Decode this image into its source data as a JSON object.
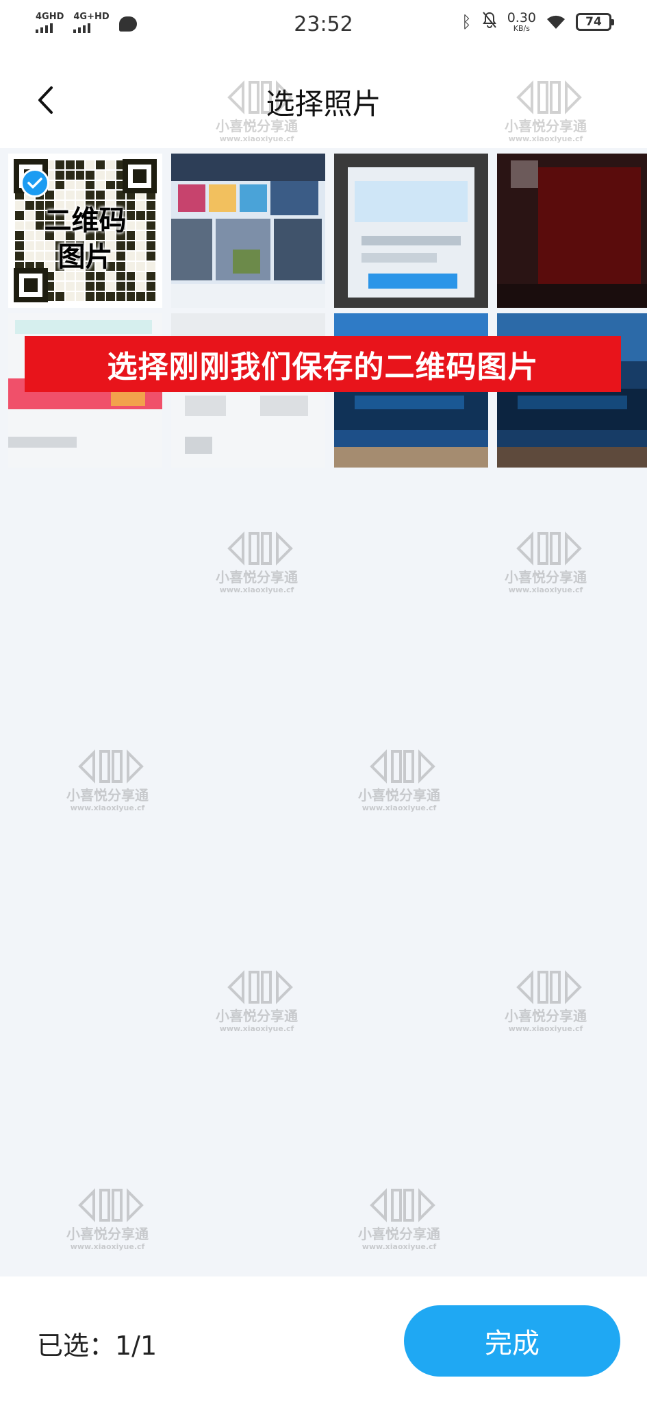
{
  "status_bar": {
    "time": "23:52",
    "sim1": "4GHD",
    "sim2": "4G+HD",
    "net_speed": "0.30",
    "net_unit": "KB/s",
    "battery": "74"
  },
  "header": {
    "title": "选择照片"
  },
  "photos": [
    {
      "name": "qr-code-photo",
      "selected": true,
      "label": "二维码\n图片"
    },
    {
      "name": "photo-2",
      "selected": false
    },
    {
      "name": "photo-3",
      "selected": false
    },
    {
      "name": "photo-4",
      "selected": false
    },
    {
      "name": "photo-5",
      "selected": false
    },
    {
      "name": "photo-6",
      "selected": false
    },
    {
      "name": "photo-7",
      "selected": false
    },
    {
      "name": "photo-8",
      "selected": false
    }
  ],
  "qr_label_line1": "二维码",
  "qr_label_line2": "图片",
  "instruction": "选择刚刚我们保存的二维码图片",
  "watermark": {
    "cn": "小喜悦分享通",
    "url": "www.xiaoxiyue.cf"
  },
  "footer": {
    "selected": "已选：1/1",
    "done": "完成"
  },
  "colors": {
    "accent": "#1fa8f3",
    "check": "#1c9cf2",
    "banner": "#e8141b"
  }
}
